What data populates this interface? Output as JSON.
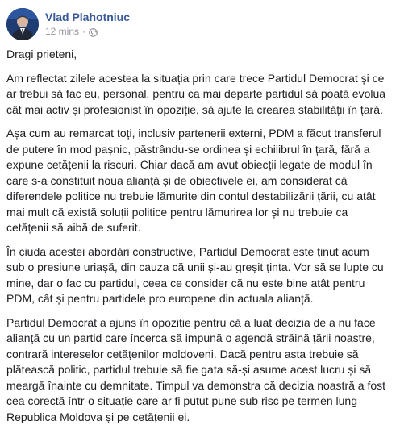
{
  "post": {
    "author": "Vlad Plahotniuc",
    "time": "12 mins",
    "separator": "·",
    "privacy_icon": "globe-icon",
    "paragraphs": [
      "Dragi prieteni,",
      "Am reflectat zilele acestea la situația prin care trece Partidul Democrat și ce ar trebui să fac eu, personal, pentru ca mai departe partidul să poată evolua cât mai activ și profesionist în opoziție, să ajute la crearea stabilității în țară.",
      "Așa cum au remarcat toți, inclusiv partenerii externi, PDM a făcut transferul de putere în mod pașnic, păstrându-se ordinea și echilibrul în țară, fără a expune cetățenii la riscuri. Chiar dacă am avut obiecții legate de modul în care s-a constituit noua alianță și de obiectivele ei, am considerat că diferendele politice nu trebuie lămurite din contul destabilizării țării, cu atât mai mult că există soluții politice pentru lămurirea lor și nu trebuie ca cetățenii să aibă de suferit.",
      "În ciuda acestei abordări constructive, Partidul Democrat este ținut acum sub o presiune uriașă, din cauza că unii și-au greșit ținta. Vor să se lupte cu mine, dar o fac cu partidul, ceea ce consider că nu este bine atât pentru PDM, cât și pentru partidele pro europene din actuala alianță.",
      "Partidul Democrat a ajuns în opoziție pentru că a luat decizia de a nu face alianță cu un partid care încerca să impună o agendă străină țării noastre, contrară intereselor cetățenilor moldoveni. Dacă pentru asta trebuie să plătească politic, partidul trebuie să fie gata să-și asume acest lucru și să meargă înainte cu demnitate. Timpul va demonstra că decizia noastră a fost cea corectă într-o situație care ar fi putut pune sub risc pe termen lung Republica Moldova și pe cetățenii ei."
    ]
  },
  "colors": {
    "author": "#385898",
    "text": "#1c1e21",
    "meta": "#90949c",
    "background": "#ffffff"
  }
}
